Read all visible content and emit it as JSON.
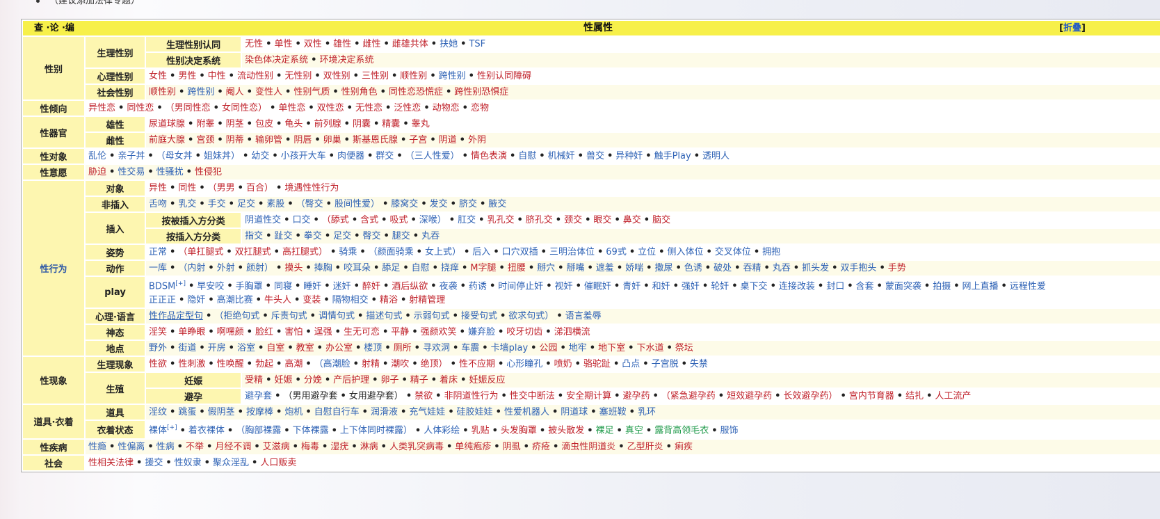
{
  "top_note": "（建议添加法律专题）",
  "navbox": {
    "vte": "查 ·论 ·编",
    "title": "性属性",
    "collapse_label": "折叠",
    "collapse_brackets": [
      "[",
      "]"
    ]
  },
  "rows": {
    "gender_label": "性别",
    "bio_sex_label": "生理性别",
    "bio_identity_label": "生理性别认同",
    "bio_identity_items": [
      {
        "t": "无性",
        "c": "red"
      },
      {
        "t": "单性",
        "c": "red"
      },
      {
        "t": "双性",
        "c": "red"
      },
      {
        "t": "雄性",
        "c": "red"
      },
      {
        "t": "雌性",
        "c": "red"
      },
      {
        "t": "雌雄共体",
        "c": "red"
      },
      {
        "t": "扶她",
        "c": "blue"
      },
      {
        "t": "TSF",
        "c": "blue"
      }
    ],
    "sex_determination_label": "性别决定系统",
    "sex_determination_items": [
      {
        "t": "染色体决定系统",
        "c": "red"
      },
      {
        "t": "环境决定系统",
        "c": "red"
      }
    ],
    "psych_gender_label": "心理性别",
    "psych_gender_items": [
      {
        "t": "女性",
        "c": "red"
      },
      {
        "t": "男性",
        "c": "red"
      },
      {
        "t": "中性",
        "c": "red"
      },
      {
        "t": "流动性别",
        "c": "red"
      },
      {
        "t": "无性别",
        "c": "red"
      },
      {
        "t": "双性别",
        "c": "red"
      },
      {
        "t": "三性别",
        "c": "red"
      },
      {
        "t": "顺性别",
        "c": "red"
      },
      {
        "t": "跨性别",
        "c": "blue"
      },
      {
        "t": "性别认同障碍",
        "c": "red"
      }
    ],
    "social_gender_label": "社会性别",
    "social_gender_items": [
      {
        "t": "顺性别",
        "c": "red"
      },
      {
        "t": "跨性别",
        "c": "blue"
      },
      {
        "t": "阉人",
        "c": "red"
      },
      {
        "t": "变性人",
        "c": "red"
      },
      {
        "t": "性别气质",
        "c": "red"
      },
      {
        "t": "性别角色",
        "c": "red"
      },
      {
        "t": "同性恋恐慌症",
        "c": "red"
      },
      {
        "t": "跨性别恐惧症",
        "c": "red"
      }
    ],
    "orientation_label": "性倾向",
    "orientation_items": [
      {
        "t": "异性恋",
        "c": "red"
      },
      {
        "t": "同性恋",
        "c": "red"
      },
      {
        "t": "（男同性恋",
        "c": "red"
      },
      {
        "t": "女同性恋）",
        "c": "red"
      },
      {
        "t": "单性恋",
        "c": "red"
      },
      {
        "t": "双性恋",
        "c": "red"
      },
      {
        "t": "无性恋",
        "c": "red"
      },
      {
        "t": "泛性恋",
        "c": "red"
      },
      {
        "t": "动物恋",
        "c": "red"
      },
      {
        "t": "恋物",
        "c": "red"
      }
    ],
    "organs_label": "性器官",
    "male_label": "雄性",
    "male_items": [
      {
        "t": "尿道球腺",
        "c": "red"
      },
      {
        "t": "附睾",
        "c": "red"
      },
      {
        "t": "阴茎",
        "c": "red"
      },
      {
        "t": "包皮",
        "c": "red"
      },
      {
        "t": "龟头",
        "c": "red"
      },
      {
        "t": "前列腺",
        "c": "red"
      },
      {
        "t": "阴囊",
        "c": "red"
      },
      {
        "t": "精囊",
        "c": "red"
      },
      {
        "t": "睾丸",
        "c": "red"
      }
    ],
    "female_label": "雌性",
    "female_items": [
      {
        "t": "前庭大腺",
        "c": "red"
      },
      {
        "t": "宫颈",
        "c": "red"
      },
      {
        "t": "阴蒂",
        "c": "red"
      },
      {
        "t": "输卵管",
        "c": "red"
      },
      {
        "t": "阴唇",
        "c": "red"
      },
      {
        "t": "卵巢",
        "c": "red"
      },
      {
        "t": "斯基恩氏腺",
        "c": "red"
      },
      {
        "t": "子宫",
        "c": "red"
      },
      {
        "t": "阴道",
        "c": "red"
      },
      {
        "t": "外阴",
        "c": "red"
      }
    ],
    "object_label": "性对象",
    "object_items": [
      {
        "t": "乱伦",
        "c": "blue"
      },
      {
        "t": "亲子丼",
        "c": "blue"
      },
      {
        "t": "（母女丼",
        "c": "blue"
      },
      {
        "t": "姐妹丼）",
        "c": "blue"
      },
      {
        "t": "幼交",
        "c": "blue"
      },
      {
        "t": "小孩开大车",
        "c": "blue"
      },
      {
        "t": "肉便器",
        "c": "blue"
      },
      {
        "t": "群交",
        "c": "blue"
      },
      {
        "t": "（三人性爱）",
        "c": "blue"
      },
      {
        "t": "情色表演",
        "c": "red"
      },
      {
        "t": "自慰",
        "c": "blue"
      },
      {
        "t": "机械奸",
        "c": "blue"
      },
      {
        "t": "兽交",
        "c": "blue"
      },
      {
        "t": "异种奸",
        "c": "blue"
      },
      {
        "t": "触手Play",
        "c": "blue"
      },
      {
        "t": "透明人",
        "c": "blue"
      }
    ],
    "will_label": "性意愿",
    "will_items": [
      {
        "t": "胁迫",
        "c": "red"
      },
      {
        "t": "性交易",
        "c": "blue"
      },
      {
        "t": "性骚扰",
        "c": "blue"
      },
      {
        "t": "性侵犯",
        "c": "red"
      }
    ],
    "behavior_label": "性行为",
    "target_label": "对象",
    "target_items": [
      {
        "t": "异性",
        "c": "red"
      },
      {
        "t": "同性",
        "c": "red"
      },
      {
        "t": "（男男",
        "c": "red"
      },
      {
        "t": "百合）",
        "c": "red"
      },
      {
        "t": "境遇性性行为",
        "c": "red"
      }
    ],
    "noninsert_label": "非插入",
    "noninsert_items": [
      {
        "t": "舌吻",
        "c": "blue"
      },
      {
        "t": "乳交",
        "c": "blue"
      },
      {
        "t": "手交",
        "c": "blue"
      },
      {
        "t": "足交",
        "c": "blue"
      },
      {
        "t": "素股",
        "c": "blue"
      },
      {
        "t": "（臀交",
        "c": "blue"
      },
      {
        "t": "股间性爱）",
        "c": "blue"
      },
      {
        "t": "膝窝交",
        "c": "blue"
      },
      {
        "t": "发交",
        "c": "blue"
      },
      {
        "t": "脐交",
        "c": "blue"
      },
      {
        "t": "腋交",
        "c": "blue"
      }
    ],
    "insert_label": "插入",
    "by_inserted_label": "按被插入方分类",
    "by_inserted_items": [
      {
        "t": "阴道性交",
        "c": "blue"
      },
      {
        "t": "口交",
        "c": "blue"
      },
      {
        "t": "（舔式",
        "c": "red"
      },
      {
        "t": "含式",
        "c": "red"
      },
      {
        "t": "吸式",
        "c": "red"
      },
      {
        "t": "深喉）",
        "c": "blue"
      },
      {
        "t": "肛交",
        "c": "blue"
      },
      {
        "t": "乳孔交",
        "c": "red"
      },
      {
        "t": "脐孔交",
        "c": "red"
      },
      {
        "t": "颈交",
        "c": "red"
      },
      {
        "t": "眼交",
        "c": "red"
      },
      {
        "t": "鼻交",
        "c": "red"
      },
      {
        "t": "脑交",
        "c": "red"
      }
    ],
    "by_inserter_label": "按插入方分类",
    "by_inserter_items": [
      {
        "t": "指交",
        "c": "blue"
      },
      {
        "t": "趾交",
        "c": "blue"
      },
      {
        "t": "拳交",
        "c": "blue"
      },
      {
        "t": "足交",
        "c": "blue"
      },
      {
        "t": "臀交",
        "c": "blue"
      },
      {
        "t": "腿交",
        "c": "blue"
      },
      {
        "t": "丸吞",
        "c": "blue"
      }
    ],
    "posture_label": "姿势",
    "posture_items": [
      {
        "t": "正常",
        "c": "blue"
      },
      {
        "t": "（单扛腿式",
        "c": "red"
      },
      {
        "t": "双扛腿式",
        "c": "red"
      },
      {
        "t": "高扛腿式）",
        "c": "red"
      },
      {
        "t": "骑乘",
        "c": "blue"
      },
      {
        "t": "（颜面骑乘",
        "c": "blue"
      },
      {
        "t": "女上式）",
        "c": "blue"
      },
      {
        "t": "后入",
        "c": "blue"
      },
      {
        "t": "口穴双插",
        "c": "blue"
      },
      {
        "t": "三明治体位",
        "c": "blue"
      },
      {
        "t": "69式",
        "c": "blue"
      },
      {
        "t": "立位",
        "c": "blue"
      },
      {
        "t": "侧入体位",
        "c": "blue"
      },
      {
        "t": "交叉体位",
        "c": "blue"
      },
      {
        "t": "拥抱",
        "c": "blue"
      }
    ],
    "action_label": "动作",
    "action_items": [
      {
        "t": "一库",
        "c": "blue"
      },
      {
        "t": "（内射",
        "c": "blue"
      },
      {
        "t": "外射",
        "c": "blue"
      },
      {
        "t": "颜射）",
        "c": "blue"
      },
      {
        "t": "摸头",
        "c": "red"
      },
      {
        "t": "捧胸",
        "c": "blue"
      },
      {
        "t": "咬耳朵",
        "c": "blue"
      },
      {
        "t": "舔足",
        "c": "blue"
      },
      {
        "t": "自慰",
        "c": "blue"
      },
      {
        "t": "挠痒",
        "c": "blue"
      },
      {
        "t": "M字腿",
        "c": "red"
      },
      {
        "t": "扭腰",
        "c": "red"
      },
      {
        "t": "掰穴",
        "c": "blue"
      },
      {
        "t": "掰嘴",
        "c": "blue"
      },
      {
        "t": "遮羞",
        "c": "blue"
      },
      {
        "t": "娇喘",
        "c": "blue"
      },
      {
        "t": "撒尿",
        "c": "blue"
      },
      {
        "t": "色诱",
        "c": "blue"
      },
      {
        "t": "破处",
        "c": "blue"
      },
      {
        "t": "吞精",
        "c": "blue"
      },
      {
        "t": "丸吞",
        "c": "blue"
      },
      {
        "t": "抓头发",
        "c": "blue"
      },
      {
        "t": "双手抱头",
        "c": "blue"
      },
      {
        "t": "手势",
        "c": "red"
      }
    ],
    "play_label": "play",
    "play_line1": [
      {
        "t": "BDSM",
        "c": "blue",
        "sup": "[+]"
      },
      {
        "t": "早安咬",
        "c": "blue"
      },
      {
        "t": "手胸罩",
        "c": "blue"
      },
      {
        "t": "同寝",
        "c": "blue"
      },
      {
        "t": "睡奸",
        "c": "blue"
      },
      {
        "t": "迷奸",
        "c": "blue"
      },
      {
        "t": "醉奸",
        "c": "red"
      },
      {
        "t": "酒后纵欲",
        "c": "red"
      },
      {
        "t": "夜袭",
        "c": "blue"
      },
      {
        "t": "药诱",
        "c": "blue"
      },
      {
        "t": "时间停止奸",
        "c": "blue"
      },
      {
        "t": "视奸",
        "c": "blue"
      },
      {
        "t": "催眠奸",
        "c": "blue"
      },
      {
        "t": "青奸",
        "c": "blue"
      },
      {
        "t": "和奸",
        "c": "blue"
      },
      {
        "t": "强奸",
        "c": "blue"
      },
      {
        "t": "轮奸",
        "c": "blue"
      },
      {
        "t": "桌下交",
        "c": "blue"
      },
      {
        "t": "连接改装",
        "c": "blue"
      },
      {
        "t": "封口",
        "c": "blue"
      },
      {
        "t": "含套",
        "c": "blue"
      },
      {
        "t": "蒙面突袭",
        "c": "blue"
      },
      {
        "t": "拍摄",
        "c": "blue"
      },
      {
        "t": "网上直播",
        "c": "blue"
      },
      {
        "t": "远程性爱",
        "c": "blue"
      }
    ],
    "play_line2": [
      {
        "t": "正正正",
        "c": "blue"
      },
      {
        "t": "隐奸",
        "c": "blue"
      },
      {
        "t": "高潮比赛",
        "c": "blue"
      },
      {
        "t": "牛头人",
        "c": "red"
      },
      {
        "t": "变装",
        "c": "red"
      },
      {
        "t": "隔物相交",
        "c": "blue"
      },
      {
        "t": "精浴",
        "c": "red"
      },
      {
        "t": "射精管理",
        "c": "red"
      }
    ],
    "mental_label": "心理·语言",
    "mental_items": [
      {
        "t": "性作品定型句",
        "c": "blue",
        "u": true
      },
      {
        "t": "（拒绝句式",
        "c": "blue"
      },
      {
        "t": "斥责句式",
        "c": "blue"
      },
      {
        "t": "调情句式",
        "c": "blue"
      },
      {
        "t": "描述句式",
        "c": "blue"
      },
      {
        "t": "示弱句式",
        "c": "blue"
      },
      {
        "t": "接受句式",
        "c": "blue"
      },
      {
        "t": "欲求句式）",
        "c": "blue"
      },
      {
        "t": "语言羞辱",
        "c": "blue"
      }
    ],
    "manner_label": "神态",
    "manner_items": [
      {
        "t": "淫笑",
        "c": "red"
      },
      {
        "t": "单睁眼",
        "c": "red"
      },
      {
        "t": "啊嘿颜",
        "c": "red"
      },
      {
        "t": "脸红",
        "c": "red"
      },
      {
        "t": "害怕",
        "c": "red"
      },
      {
        "t": "逞强",
        "c": "red"
      },
      {
        "t": "生无可恋",
        "c": "red"
      },
      {
        "t": "平静",
        "c": "red"
      },
      {
        "t": "强颜欢笑",
        "c": "red"
      },
      {
        "t": "嫌弃脸",
        "c": "blue"
      },
      {
        "t": "咬牙切齿",
        "c": "red"
      },
      {
        "t": "涕泗横流",
        "c": "red"
      }
    ],
    "place_label": "地点",
    "place_items": [
      {
        "t": "野外",
        "c": "blue"
      },
      {
        "t": "街道",
        "c": "blue"
      },
      {
        "t": "开房",
        "c": "blue"
      },
      {
        "t": "浴室",
        "c": "blue"
      },
      {
        "t": "自室",
        "c": "red"
      },
      {
        "t": "教室",
        "c": "red"
      },
      {
        "t": "办公室",
        "c": "red"
      },
      {
        "t": "楼顶",
        "c": "blue"
      },
      {
        "t": "厕所",
        "c": "red"
      },
      {
        "t": "寻欢洞",
        "c": "blue"
      },
      {
        "t": "车震",
        "c": "blue"
      },
      {
        "t": "卡墙play",
        "c": "blue"
      },
      {
        "t": "公园",
        "c": "red"
      },
      {
        "t": "地牢",
        "c": "blue"
      },
      {
        "t": "地下室",
        "c": "red"
      },
      {
        "t": "下水道",
        "c": "red"
      },
      {
        "t": "祭坛",
        "c": "red"
      }
    ],
    "phenomena_label": "性现象",
    "physio_label": "生理现象",
    "physio_items": [
      {
        "t": "性欲",
        "c": "red"
      },
      {
        "t": "性刺激",
        "c": "red"
      },
      {
        "t": "性唤醒",
        "c": "red"
      },
      {
        "t": "勃起",
        "c": "red"
      },
      {
        "t": "高潮",
        "c": "red"
      },
      {
        "t": "（高潮脸",
        "c": "blue"
      },
      {
        "t": "射精",
        "c": "red"
      },
      {
        "t": "潮吹",
        "c": "red"
      },
      {
        "t": "绝顶）",
        "c": "red"
      },
      {
        "t": "性不应期",
        "c": "red"
      },
      {
        "t": "心形瞳孔",
        "c": "blue"
      },
      {
        "t": "喷奶",
        "c": "red"
      },
      {
        "t": "骆驼趾",
        "c": "red"
      },
      {
        "t": "凸点",
        "c": "blue"
      },
      {
        "t": "子宫脱",
        "c": "blue"
      },
      {
        "t": "失禁",
        "c": "blue"
      }
    ],
    "repro_label": "生殖",
    "pregnancy_label": "妊娠",
    "pregnancy_items": [
      {
        "t": "受精",
        "c": "red"
      },
      {
        "t": "妊娠",
        "c": "red"
      },
      {
        "t": "分娩",
        "c": "red"
      },
      {
        "t": "产后护理",
        "c": "red"
      },
      {
        "t": "卵子",
        "c": "red"
      },
      {
        "t": "精子",
        "c": "red"
      },
      {
        "t": "着床",
        "c": "red"
      },
      {
        "t": "妊娠反应",
        "c": "red"
      }
    ],
    "contra_label": "避孕",
    "contra_items": [
      {
        "t": "避孕套",
        "c": "blue"
      },
      {
        "t": "（男用避孕套",
        "c": "dark"
      },
      {
        "t": "女用避孕套）",
        "c": "dark"
      },
      {
        "t": "禁欲",
        "c": "red"
      },
      {
        "t": "非阴道性行为",
        "c": "red"
      },
      {
        "t": "性交中断法",
        "c": "red"
      },
      {
        "t": "安全期计算",
        "c": "red"
      },
      {
        "t": "避孕药",
        "c": "red"
      },
      {
        "t": "（紧急避孕药",
        "c": "red"
      },
      {
        "t": "短效避孕药",
        "c": "red"
      },
      {
        "t": "长效避孕药）",
        "c": "red"
      },
      {
        "t": "宫内节育器",
        "c": "red"
      },
      {
        "t": "结扎",
        "c": "red"
      },
      {
        "t": "人工流产",
        "c": "red"
      }
    ],
    "props_label": "道具·衣着",
    "tools_label": "道具",
    "tools_items": [
      {
        "t": "淫纹",
        "c": "blue"
      },
      {
        "t": "跳蛋",
        "c": "blue"
      },
      {
        "t": "假阴茎",
        "c": "blue"
      },
      {
        "t": "按摩棒",
        "c": "blue"
      },
      {
        "t": "炮机",
        "c": "blue"
      },
      {
        "t": "自慰自行车",
        "c": "blue"
      },
      {
        "t": "润滑液",
        "c": "blue"
      },
      {
        "t": "充气娃娃",
        "c": "blue"
      },
      {
        "t": "硅胶娃娃",
        "c": "blue"
      },
      {
        "t": "性爱机器人",
        "c": "blue"
      },
      {
        "t": "阴道球",
        "c": "blue"
      },
      {
        "t": "塞班鞍",
        "c": "blue"
      },
      {
        "t": "乳环",
        "c": "blue"
      }
    ],
    "clothes_label": "衣着状态",
    "clothes_items": [
      {
        "t": "裸体",
        "c": "blue",
        "sup": "[+]"
      },
      {
        "t": "着衣裸体",
        "c": "blue"
      },
      {
        "t": "（胸部裸露",
        "c": "blue"
      },
      {
        "t": "下体裸露",
        "c": "blue"
      },
      {
        "t": "上下体同时裸露）",
        "c": "blue"
      },
      {
        "t": "人体彩绘",
        "c": "blue"
      },
      {
        "t": "乳贴",
        "c": "red"
      },
      {
        "t": "头发胸罩",
        "c": "red"
      },
      {
        "t": "披头散发",
        "c": "red"
      },
      {
        "t": "裸足",
        "c": "grn"
      },
      {
        "t": "真空",
        "c": "grn"
      },
      {
        "t": "露背高领毛衣",
        "c": "grn"
      },
      {
        "t": "服饰",
        "c": "blue"
      }
    ],
    "disease_label": "性疾病",
    "disease_items": [
      {
        "t": "性瘾",
        "c": "blue"
      },
      {
        "t": "性偏离",
        "c": "blue"
      },
      {
        "t": "性病",
        "c": "blue"
      },
      {
        "t": "不举",
        "c": "red"
      },
      {
        "t": "月经不调",
        "c": "red"
      },
      {
        "t": "艾滋病",
        "c": "red"
      },
      {
        "t": "梅毒",
        "c": "red"
      },
      {
        "t": "湿疣",
        "c": "red"
      },
      {
        "t": "淋病",
        "c": "red"
      },
      {
        "t": "人类乳突病毒",
        "c": "red"
      },
      {
        "t": "单纯疱疹",
        "c": "red"
      },
      {
        "t": "阴虱",
        "c": "red"
      },
      {
        "t": "疥疮",
        "c": "red"
      },
      {
        "t": "滴虫性阴道炎",
        "c": "red"
      },
      {
        "t": "乙型肝炎",
        "c": "red"
      },
      {
        "t": "痢疾",
        "c": "red"
      }
    ],
    "society_label": "社会",
    "society_items": [
      {
        "t": "性相关法律",
        "c": "red"
      },
      {
        "t": "援交",
        "c": "blue"
      },
      {
        "t": "性奴隶",
        "c": "blue"
      },
      {
        "t": "聚众淫乱",
        "c": "blue"
      },
      {
        "t": "人口贩卖",
        "c": "red"
      }
    ]
  },
  "colors": {
    "title_bar": "#f7f04a",
    "group_bg": "#fdf6b0",
    "link_blue": "#2e62b5",
    "link_red": "#c0222b",
    "link_green": "#1f9a4a"
  }
}
